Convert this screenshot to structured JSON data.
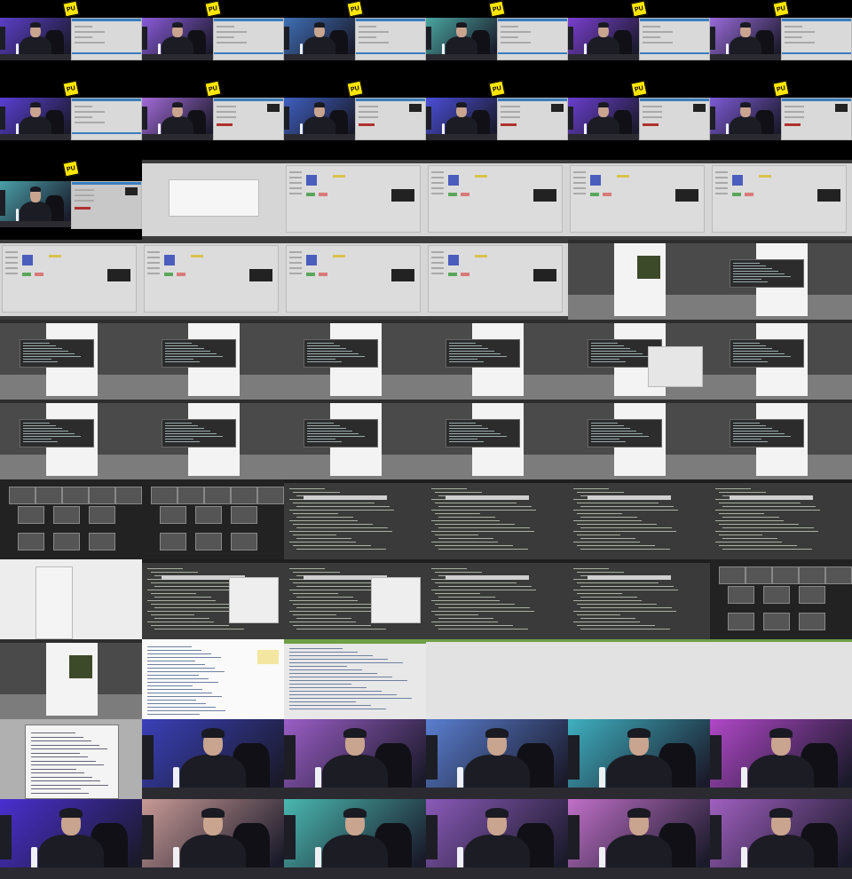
{
  "contact_sheet": {
    "columns": 6,
    "rows": 11
  },
  "badge": {
    "icon": "yellow-sticker-icon",
    "text": "PU",
    "color": "#ffe600"
  },
  "frames": [
    {
      "kind": "stream",
      "layout": "a",
      "cam": "#5b3fc9"
    },
    {
      "kind": "stream",
      "layout": "a",
      "cam": "#8a5bd9"
    },
    {
      "kind": "stream",
      "layout": "a",
      "cam": "#3f6fb5"
    },
    {
      "kind": "stream",
      "layout": "a",
      "cam": "#4aa6a0"
    },
    {
      "kind": "stream",
      "layout": "a",
      "cam": "#7a3fd0"
    },
    {
      "kind": "stream",
      "layout": "a",
      "cam": "#9a6bdb"
    },
    {
      "kind": "stream",
      "layout": "a",
      "cam": "#5a3fd4"
    },
    {
      "kind": "stream",
      "layout": "b",
      "cam": "#a36bd8"
    },
    {
      "kind": "stream",
      "layout": "b",
      "cam": "#3f5fc0"
    },
    {
      "kind": "stream",
      "layout": "b",
      "cam": "#4b4fd8"
    },
    {
      "kind": "stream",
      "layout": "b",
      "cam": "#6a3fd0"
    },
    {
      "kind": "stream",
      "layout": "b",
      "cam": "#7d5bd6"
    },
    {
      "kind": "stream",
      "layout": "c",
      "cam": "#4aa0a8"
    },
    {
      "kind": "desktop-dialog"
    },
    {
      "kind": "desktop-app"
    },
    {
      "kind": "desktop-app"
    },
    {
      "kind": "desktop-app"
    },
    {
      "kind": "desktop-app"
    },
    {
      "kind": "desktop-app"
    },
    {
      "kind": "desktop-app"
    },
    {
      "kind": "desktop-app"
    },
    {
      "kind": "desktop-app"
    },
    {
      "kind": "desktop-tweet"
    },
    {
      "kind": "desktop-tweet-term"
    },
    {
      "kind": "desktop-tweet-term"
    },
    {
      "kind": "desktop-tweet-term"
    },
    {
      "kind": "desktop-tweet-term"
    },
    {
      "kind": "desktop-tweet-term"
    },
    {
      "kind": "desktop-tweet-term",
      "popup": true
    },
    {
      "kind": "desktop-tweet-term"
    },
    {
      "kind": "desktop-tweet-term"
    },
    {
      "kind": "desktop-tweet-term"
    },
    {
      "kind": "desktop-tweet-term"
    },
    {
      "kind": "desktop-tweet-term"
    },
    {
      "kind": "desktop-tweet-term"
    },
    {
      "kind": "desktop-tweet-term"
    },
    {
      "kind": "overview"
    },
    {
      "kind": "overview"
    },
    {
      "kind": "terminal"
    },
    {
      "kind": "terminal"
    },
    {
      "kind": "terminal"
    },
    {
      "kind": "terminal"
    },
    {
      "kind": "blank-app"
    },
    {
      "kind": "terminal",
      "popup": true
    },
    {
      "kind": "terminal",
      "popup": true
    },
    {
      "kind": "terminal"
    },
    {
      "kind": "terminal"
    },
    {
      "kind": "overview"
    },
    {
      "kind": "desktop-tweet"
    },
    {
      "kind": "search-page"
    },
    {
      "kind": "webpage"
    },
    {
      "kind": "webpage-blank"
    },
    {
      "kind": "webpage-blank"
    },
    {
      "kind": "webpage-blank"
    },
    {
      "kind": "filemanager"
    },
    {
      "kind": "cam",
      "cam": "#3a40b8"
    },
    {
      "kind": "cam",
      "cam": "#9a5ec6"
    },
    {
      "kind": "cam",
      "cam": "#5a7fd0"
    },
    {
      "kind": "cam",
      "cam": "#3fb0c0"
    },
    {
      "kind": "cam",
      "cam": "#b048c8"
    },
    {
      "kind": "cam",
      "cam": "#4a2fd0"
    },
    {
      "kind": "cam",
      "cam": "#c89a96"
    },
    {
      "kind": "cam",
      "cam": "#4ab8b0"
    },
    {
      "kind": "cam",
      "cam": "#8a5ab8"
    },
    {
      "kind": "cam",
      "cam": "#c070c8"
    },
    {
      "kind": "cam",
      "cam": "#a060c0"
    }
  ]
}
